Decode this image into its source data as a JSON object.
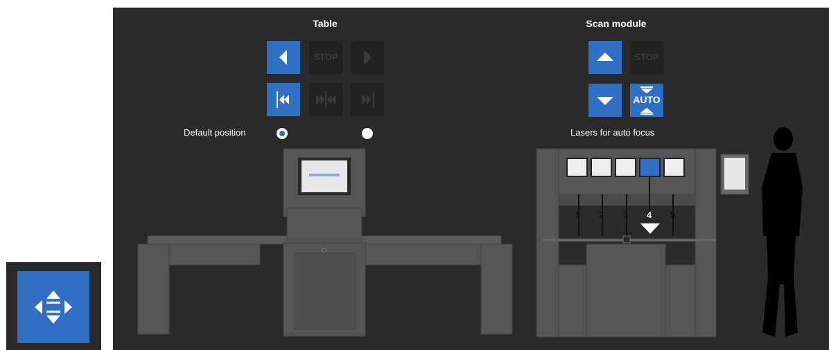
{
  "table": {
    "title": "Table",
    "stop_label": "STOP",
    "default_position_label": "Default position"
  },
  "scan_module": {
    "title": "Scan module",
    "stop_label": "STOP",
    "auto_label": "AUTO",
    "lasers_label": "Lasers for auto focus"
  },
  "lasers": {
    "labels": [
      "1",
      "2",
      "3",
      "4",
      "5"
    ],
    "selected": "4"
  },
  "colors": {
    "background": "#2a2a2a",
    "accent": "#2f6fc4",
    "machine": "#555555",
    "inactive_button": "#222222"
  }
}
